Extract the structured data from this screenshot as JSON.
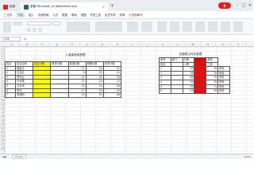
{
  "tabs": [
    {
      "label": "稻壳",
      "icon_color": "#e2231a"
    },
    {
      "label": "新建 Microsoft_xx Worksheet.xlsx",
      "icon_color": "#1e7145"
    }
  ],
  "logo_text": "S",
  "menu": [
    "三 文件",
    "开始",
    "插入",
    "页面布局",
    "公式",
    "数据",
    "审阅",
    "视图",
    "开发工具",
    "会员专享",
    "效率",
    "Q 查找命令"
  ],
  "formula_bar": {
    "cell_ref": "C14",
    "fx": "fx"
  },
  "columns": [
    "A",
    "B",
    "C",
    "D",
    "E",
    "F",
    "G",
    "H",
    "I",
    "J",
    "K",
    "L",
    "M",
    "N",
    "O",
    "P"
  ],
  "rows": [
    "1",
    "2",
    "3",
    "4",
    "5",
    "6",
    "7",
    "8",
    "9",
    "10",
    "11",
    "12",
    "13",
    "14",
    "15",
    "16",
    "17",
    "18",
    "19",
    "20",
    "21",
    "22",
    "23",
    "24",
    "25",
    "26"
  ],
  "table1": {
    "caption": "八省高考成绩表",
    "header": [
      "姓名",
      "姓名名称",
      "语文分数",
      "数学分数",
      "英语分数",
      "物理分数",
      "化学分数"
    ],
    "rows": [
      [
        "1",
        "胡启江",
        "",
        "",
        17,
        24,
        51
      ],
      [
        "2",
        "王启云",
        "",
        "",
        9,
        31,
        41
      ],
      [
        "3",
        "黄先云",
        "",
        "",
        17,
        42,
        24
      ],
      [
        "4",
        "许长城",
        "",
        "",
        21,
        24,
        31
      ],
      [
        "5",
        "王忠华",
        "",
        "",
        22,
        24,
        26
      ],
      [
        "6",
        "李平",
        "",
        "",
        17,
        34,
        43
      ],
      [
        "7",
        "黄国利",
        "",
        "",
        19,
        23,
        46
      ]
    ]
  },
  "table2": {
    "caption": "出勤表公司记录表",
    "header": [
      "序号",
      "部门",
      "分数",
      "统计",
      "类别"
    ],
    "sub_header": [
      "姓名",
      "",
      "入职",
      "",
      "工资"
    ],
    "rows": [
      [
        "1",
        "",
        "58",
        "",
        "76",
        "黄色"
      ],
      [
        "2",
        "",
        "56",
        "",
        "78",
        "黄色"
      ],
      [
        "3",
        "",
        "68",
        "",
        "79",
        "黄色"
      ],
      [
        "4",
        "",
        "59",
        "",
        "76",
        "黄色"
      ],
      [
        "5",
        "",
        "52",
        "",
        "71",
        "黄色"
      ],
      [
        "6",
        "",
        "54",
        "",
        "78",
        "黄色"
      ]
    ]
  },
  "status": {
    "sheet": "Sheet1",
    "zoom": "100%"
  }
}
